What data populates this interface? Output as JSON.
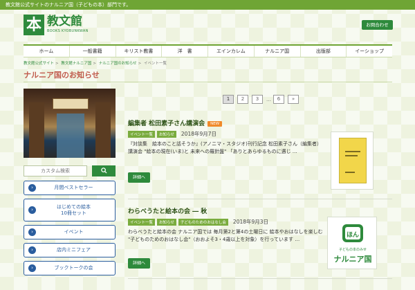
{
  "topbar": {
    "text": "教文館公式サイトのナルニア国（子どもの本）部門です。"
  },
  "logo": {
    "mark": "本",
    "name": "教文館",
    "sub": "BOOKS KYOBUNKWAN"
  },
  "header": {
    "contact_label": "お問合わせ"
  },
  "nav": [
    "ホーム",
    "一般書籍",
    "キリスト教書",
    "洋　書",
    "エインカレム",
    "ナルニア国",
    "出版部",
    "イーショップ"
  ],
  "breadcrumb": [
    "教文館公式サイト",
    "教文館ナルニア国",
    "ナルニア国のお知らせ",
    "イベント一覧"
  ],
  "page": {
    "title": "ナルニア国のお知らせ"
  },
  "search": {
    "placeholder": "カスタム検索",
    "button_icon": "search-icon"
  },
  "sidebar": {
    "items": [
      {
        "label": "月間ベストセラー",
        "lines": 1
      },
      {
        "label": "はじめての絵本",
        "label2": "10冊セット",
        "lines": 2
      },
      {
        "label": "イベント",
        "lines": 1
      },
      {
        "label": "店内ミニフェア",
        "lines": 1
      },
      {
        "label": "ブックトークの会",
        "lines": 1
      }
    ]
  },
  "pager": {
    "pages": [
      "1",
      "2",
      "3",
      "…",
      "6",
      "»"
    ],
    "current": "1"
  },
  "articles": [
    {
      "title": "編集者 松田素子さん講演会",
      "badge": "NEW",
      "tags": [
        "イベント一覧",
        "お知らせ"
      ],
      "date": "2018年9月7日",
      "excerpt": "『対談集　絵本のこと話そうか』(アノニマ・スタジオ)刊行記念 松田素子さん（編集者）講演会 \"絵本の現在(いま)と 未来への羅針盤\" 「ありとあらゆるものに遇じ …",
      "button": "詳細へ"
    },
    {
      "title": "わらべうたと絵本の会 ― 秋",
      "tags": [
        "イベント一覧",
        "お知らせ",
        "子どものためのおはなし会"
      ],
      "date": "2018年9月3日",
      "excerpt": "わらべうたと絵本の会 ナルニア国では 毎月第2と第4の土曜日に 絵本やおはなしを楽しむ \"子どものためのおはなし会\"（おおよそ3・4歳以上を対象）を行っています …",
      "button": "詳細へ",
      "thumb_text": [
        "子どもの本のみせ",
        "ナルニア国"
      ],
      "thumb_mark": "ほん"
    }
  ],
  "colors": {
    "brand_green": "#2e8a3c",
    "accent_red": "#c05b4c",
    "side_blue": "#2a5d9e",
    "tag_green": "#7aac3e",
    "new_orange": "#f08a2a"
  }
}
